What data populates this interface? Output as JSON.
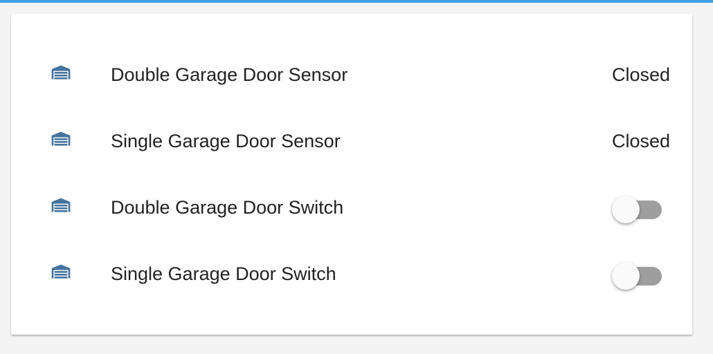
{
  "colors": {
    "accent": "#3ea2ee",
    "icon": "#44739e",
    "toggle_off_track": "#9e9e9e",
    "toggle_thumb": "#fafafa",
    "text": "#222222"
  },
  "entities": [
    {
      "icon": "garage-icon",
      "name": "Double Garage Door Sensor",
      "type": "sensor",
      "state": "Closed"
    },
    {
      "icon": "garage-icon",
      "name": "Single Garage Door Sensor",
      "type": "sensor",
      "state": "Closed"
    },
    {
      "icon": "garage-icon",
      "name": "Double Garage Door Switch",
      "type": "switch",
      "on": false
    },
    {
      "icon": "garage-icon",
      "name": "Single Garage Door Switch",
      "type": "switch",
      "on": false
    }
  ]
}
